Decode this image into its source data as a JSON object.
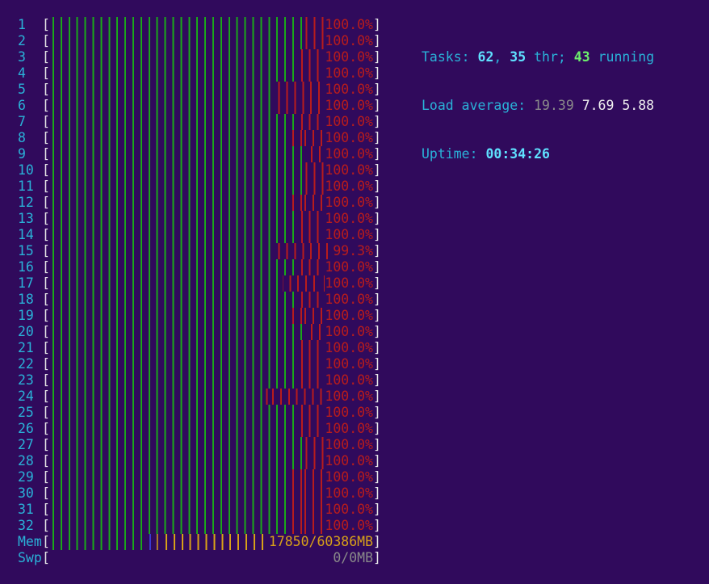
{
  "summary": {
    "tasks_label": "Tasks:",
    "tasks_count": "62",
    "comma": ",",
    "threads_count": "35",
    "threads_label": "thr;",
    "running_count": "43",
    "running_label": "running",
    "load_label": "Load average:",
    "load_1": "19.39",
    "load_5": "7.69",
    "load_15": "5.88",
    "uptime_label": "Uptime:",
    "uptime_value": "00:34:26"
  },
  "cpus": [
    {
      "label": "1",
      "value": "100.0%",
      "green": 0.78,
      "red": 0.22
    },
    {
      "label": "2",
      "value": "100.0%",
      "green": 0.78,
      "red": 0.22
    },
    {
      "label": "3",
      "value": "100.0%",
      "green": 0.76,
      "red": 0.24
    },
    {
      "label": "4",
      "value": "100.0%",
      "green": 0.76,
      "red": 0.24
    },
    {
      "label": "5",
      "value": "100.0%",
      "green": 0.7,
      "red": 0.3
    },
    {
      "label": "6",
      "value": "100.0%",
      "green": 0.7,
      "red": 0.3
    },
    {
      "label": "7",
      "value": "100.0%",
      "green": 0.76,
      "red": 0.24
    },
    {
      "label": "8",
      "value": "100.0%",
      "green": 0.74,
      "red": 0.26
    },
    {
      "label": "9",
      "value": "100.0%",
      "green": 0.8,
      "red": 0.2
    },
    {
      "label": "10",
      "value": "100.0%",
      "green": 0.78,
      "red": 0.22
    },
    {
      "label": "11",
      "value": "100.0%",
      "green": 0.78,
      "red": 0.22
    },
    {
      "label": "12",
      "value": "100.0%",
      "green": 0.74,
      "red": 0.26
    },
    {
      "label": "13",
      "value": "100.0%",
      "green": 0.76,
      "red": 0.24
    },
    {
      "label": "14",
      "value": "100.0%",
      "green": 0.76,
      "red": 0.24
    },
    {
      "label": "15",
      "value": "99.3%",
      "green": 0.7,
      "red": 0.3
    },
    {
      "label": "16",
      "value": "100.0%",
      "green": 0.76,
      "red": 0.24
    },
    {
      "label": "17",
      "value": "100.0%",
      "green": 0.72,
      "red": 0.28
    },
    {
      "label": "18",
      "value": "100.0%",
      "green": 0.76,
      "red": 0.24
    },
    {
      "label": "19",
      "value": "100.0%",
      "green": 0.74,
      "red": 0.26
    },
    {
      "label": "20",
      "value": "100.0%",
      "green": 0.8,
      "red": 0.2
    },
    {
      "label": "21",
      "value": "100.0%",
      "green": 0.76,
      "red": 0.24
    },
    {
      "label": "22",
      "value": "100.0%",
      "green": 0.76,
      "red": 0.24
    },
    {
      "label": "23",
      "value": "100.0%",
      "green": 0.76,
      "red": 0.24
    },
    {
      "label": "24",
      "value": "100.0%",
      "green": 0.66,
      "red": 0.34
    },
    {
      "label": "25",
      "value": "100.0%",
      "green": 0.76,
      "red": 0.24
    },
    {
      "label": "26",
      "value": "100.0%",
      "green": 0.76,
      "red": 0.24
    },
    {
      "label": "27",
      "value": "100.0%",
      "green": 0.78,
      "red": 0.22
    },
    {
      "label": "28",
      "value": "100.0%",
      "green": 0.78,
      "red": 0.22
    },
    {
      "label": "29",
      "value": "100.0%",
      "green": 0.74,
      "red": 0.26
    },
    {
      "label": "30",
      "value": "100.0%",
      "green": 0.74,
      "red": 0.26
    },
    {
      "label": "31",
      "value": "100.0%",
      "green": 0.74,
      "red": 0.26
    },
    {
      "label": "32",
      "value": "100.0%",
      "green": 0.74,
      "red": 0.26
    }
  ],
  "mem": {
    "label": "Mem",
    "value": "17850/60386MB",
    "green": 0.3,
    "blue": 0.03,
    "yellow": 0.35
  },
  "swp": {
    "label": "Swp",
    "value": "0/0MB"
  },
  "brackets": {
    "open": "[",
    "close": "]"
  },
  "colors": {
    "background": "#300a5c",
    "label": "#2ab2d8",
    "bar_green": "#1aa81a",
    "bar_red": "#b81c1c",
    "bar_yellow": "#d8a019",
    "bar_blue": "#3a3ad0"
  }
}
